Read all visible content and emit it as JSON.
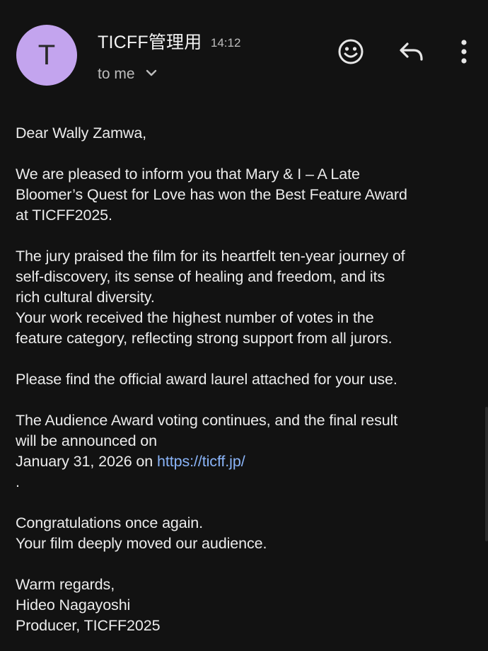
{
  "header": {
    "avatar_letter": "T",
    "sender": "TICFF管理用",
    "time": "14:12",
    "recipient": "to me",
    "icons": {
      "emoji": "emoji-react-icon",
      "reply": "reply-icon",
      "more": "more-vert-icon",
      "chevron": "chevron-down-icon"
    }
  },
  "message": {
    "greeting": "Dear Wally Zamwa,",
    "p1_line1": "We are pleased to inform you that Mary & I – A Late",
    "p1_line2": "Bloomer’s Quest for Love has won the Best Feature Award",
    "p1_line3": "at TICFF2025.",
    "p2_line1": "The jury praised the film for its heartfelt ten-year journey of",
    "p2_line2": "self-discovery, its sense of healing and freedom, and its",
    "p2_line3": "rich cultural diversity.",
    "p2_line4": "Your work received the highest number of votes in the",
    "p2_line5": "feature category, reflecting strong support from all jurors.",
    "p3": "Please find the official award laurel attached for your use.",
    "p4_line1": "The Audience Award voting continues, and the final result",
    "p4_line2": "will be announced on",
    "p4_line3_prefix": "January 31, 2026 on ",
    "p4_link": "https://ticff.jp/",
    "p4_line4": ".",
    "p5_line1": "Congratulations once again.",
    "p5_line2": "Your film deeply moved our audience.",
    "signoff": "Warm regards,",
    "signer_name": "Hideo Nagayoshi",
    "signer_title": "Producer, TICFF2025"
  },
  "colors": {
    "background": "#121212",
    "avatar": "#c3a4ee",
    "link": "#8ab4f8",
    "text": "#ececec",
    "muted": "#bdbdbd"
  }
}
